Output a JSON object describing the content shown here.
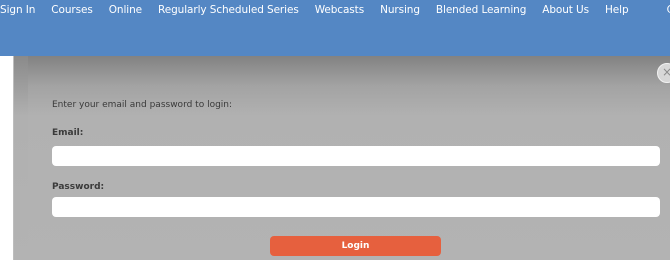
{
  "nav": {
    "items": [
      {
        "label": "Sign In"
      },
      {
        "label": "Courses"
      },
      {
        "label": "Online"
      },
      {
        "label": "Regularly Scheduled Series"
      },
      {
        "label": "Webcasts"
      },
      {
        "label": "Nursing"
      },
      {
        "label": "Blended Learning"
      },
      {
        "label": "About Us"
      },
      {
        "label": "Help"
      }
    ],
    "corner_fragment": "C"
  },
  "login_modal": {
    "close_glyph": "×",
    "instructions": "Enter your email and password to login:",
    "email_label": "Email:",
    "email_value": "",
    "password_label": "Password:",
    "password_value": "",
    "login_label": "Login"
  },
  "colors": {
    "header_bg": "#5487c4",
    "modal_bg": "#b3b3b3",
    "login_button": "#e6603e"
  }
}
